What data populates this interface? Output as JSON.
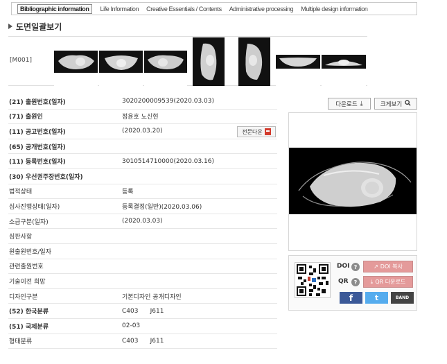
{
  "tabs": [
    {
      "label": "Bibliographic information",
      "active": true
    },
    {
      "label": "Life Information",
      "active": false
    },
    {
      "label": "Creative Essentials / Contents",
      "active": false
    },
    {
      "label": "Administrative processing",
      "active": false
    },
    {
      "label": "Multiple design information",
      "active": false
    }
  ],
  "section_title": "도면일괄보기",
  "drawing_code": "[M001]",
  "thumbnails": [
    {
      "icon": "mask-front-view"
    },
    {
      "icon": "mask-front-view"
    },
    {
      "icon": "mask-front-view"
    },
    {
      "icon": "mask-side-view"
    },
    {
      "icon": "mask-side-view"
    },
    {
      "icon": "mask-top-view"
    },
    {
      "icon": "mask-bottom-view"
    }
  ],
  "fields": [
    {
      "label": "(21) 출원번호(일자)",
      "value": "3020200009539(2020.03.03)",
      "bold": true
    },
    {
      "label": "(71) 출원인",
      "value": "정윤호 노신현",
      "bold": true
    },
    {
      "label": "(11) 공고번호(일자)",
      "value": "(2020.03.20)",
      "bold": true
    },
    {
      "label": "(65) 공개번호(일자)",
      "value": "",
      "bold": true
    },
    {
      "label": "(11) 등록번호(일자)",
      "value": "3010514710000(2020.03.16)",
      "bold": true
    },
    {
      "label": "(30) 우선권주장번호(일자)",
      "value": "",
      "bold": true
    },
    {
      "label": "법적상태",
      "value": "등록",
      "bold": false
    },
    {
      "label": "심사진행상태(일자)",
      "value": "등록결정(일반)(2020.03.06)",
      "bold": false
    },
    {
      "label": "소급구분(일자)",
      "value": "(2020.03.03)",
      "bold": false
    },
    {
      "label": "심판사항",
      "value": "",
      "bold": false
    },
    {
      "label": "원출원번호/일자",
      "value": "",
      "bold": false
    },
    {
      "label": "관련출원번호",
      "value": "",
      "bold": false
    },
    {
      "label": "기술이전 희망",
      "value": "",
      "bold": false
    },
    {
      "label": "디자인구분",
      "value": "기본디자인 공개디자인",
      "bold": false
    },
    {
      "label": "(52) 한국분류",
      "value": "C403      J611",
      "bold": true
    },
    {
      "label": "(51) 국제분류",
      "value": "02-03",
      "bold": true
    },
    {
      "label": "형태분류",
      "value": "C403      J611",
      "bold": false
    }
  ],
  "fulltext_button": "전문다운",
  "download_button": "다운로드",
  "zoom_button": "크게보기",
  "doi_label": "DOI",
  "qr_label": "QR",
  "doi_copy_button": "DOI 복사",
  "qr_download_button": "QR 다운로드",
  "social": {
    "facebook": "f",
    "twitter": "t",
    "band": "BAND"
  },
  "colors": {
    "accent_pink": "#e49a9a",
    "facebook": "#3b5998",
    "twitter": "#55acee"
  }
}
